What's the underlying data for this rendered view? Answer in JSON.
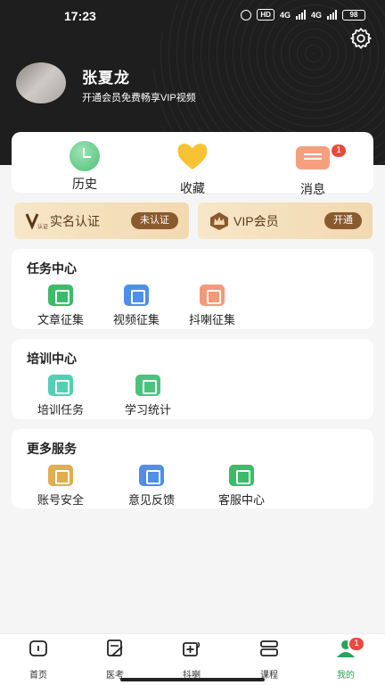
{
  "status": {
    "time": "17:23",
    "hd": "HD",
    "net1": "4G",
    "net2": "4G",
    "battery": "98"
  },
  "profile": {
    "name": "张夏龙",
    "vip_tip": "开通会员免费畅享VIP视频"
  },
  "quick": [
    {
      "label": "历史",
      "icon": "history-icon"
    },
    {
      "label": "收藏",
      "icon": "heart-icon"
    },
    {
      "label": "消息",
      "icon": "message-icon",
      "badge": "1"
    }
  ],
  "banners": {
    "verify": {
      "label": "实名认证",
      "button": "未认证",
      "icon_text": "认证"
    },
    "vip": {
      "label": "VIP会员",
      "button": "开通"
    }
  },
  "tasks": {
    "title": "任务中心",
    "items": [
      {
        "label": "文章征集",
        "color": "#3dba6a"
      },
      {
        "label": "视频征集",
        "color": "#4e8fe8"
      },
      {
        "label": "抖喇征集",
        "color": "#f29a7a"
      }
    ]
  },
  "training": {
    "title": "培训中心",
    "items": [
      {
        "label": "培训任务",
        "color": "#53cfb4"
      },
      {
        "label": "学习统计",
        "color": "#4dc27e"
      }
    ]
  },
  "services": {
    "title": "更多服务",
    "items": [
      {
        "label": "账号安全",
        "color": "#e0ae4e"
      },
      {
        "label": "意见反馈",
        "color": "#4e8fe8"
      },
      {
        "label": "客服中心",
        "color": "#3dba6a"
      }
    ]
  },
  "tabs": [
    {
      "label": "首页"
    },
    {
      "label": "医考"
    },
    {
      "label": "抖喇"
    },
    {
      "label": "课程"
    },
    {
      "label": "我的",
      "badge": "1"
    }
  ],
  "colors": {
    "accent": "#27a35a",
    "header": "#1e1e1e",
    "badge": "#e84a3e"
  }
}
